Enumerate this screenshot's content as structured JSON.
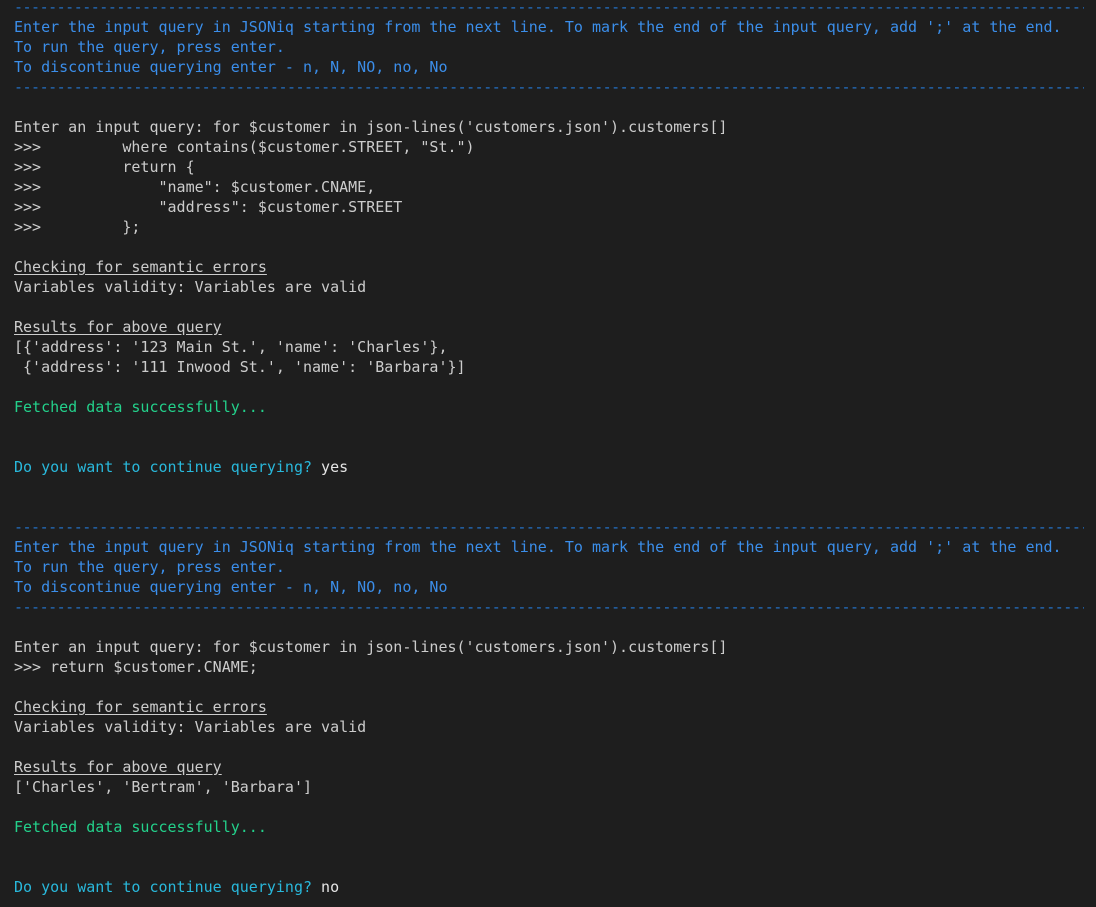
{
  "dashes": "--------------------------------------------------------------------------------------------------------------------------------------------",
  "colors": {
    "background": "#1e1e1e",
    "text": "#cccccc",
    "info_blue": "#3b8eea",
    "prompt_cyan": "#29b8db",
    "success_green": "#23d18b"
  },
  "session1": {
    "header": {
      "line1": "Enter the input query in JSONiq starting from the next line. To mark the end of the input query, add ';' at the end.",
      "line2": "To run the query, press enter.",
      "line3": "To discontinue querying enter - n, N, NO, no, No"
    },
    "query_lines": [
      "Enter an input query: for $customer in json-lines('customers.json').customers[]",
      ">>>         where contains($customer.STREET, \"St.\")",
      ">>>         return {",
      ">>>             \"name\": $customer.CNAME,",
      ">>>             \"address\": $customer.STREET",
      ">>>         };"
    ],
    "semantic_heading": "Checking for semantic errors",
    "validity": "Variables validity: Variables are valid",
    "results_heading": "Results for above query",
    "results_lines": [
      "[{'address': '123 Main St.', 'name': 'Charles'},",
      " {'address': '111 Inwood St.', 'name': 'Barbara'}]"
    ],
    "fetched": "Fetched data successfully...",
    "continue_prompt": "Do you want to continue querying? ",
    "continue_answer": "yes"
  },
  "session2": {
    "header": {
      "line1": "Enter the input query in JSONiq starting from the next line. To mark the end of the input query, add ';' at the end.",
      "line2": "To run the query, press enter.",
      "line3": "To discontinue querying enter - n, N, NO, no, No"
    },
    "query_lines": [
      "Enter an input query: for $customer in json-lines('customers.json').customers[]",
      ">>> return $customer.CNAME;"
    ],
    "semantic_heading": "Checking for semantic errors",
    "validity": "Variables validity: Variables are valid",
    "results_heading": "Results for above query",
    "results_lines": [
      "['Charles', 'Bertram', 'Barbara']"
    ],
    "fetched": "Fetched data successfully...",
    "continue_prompt": "Do you want to continue querying? ",
    "continue_answer": "no"
  }
}
